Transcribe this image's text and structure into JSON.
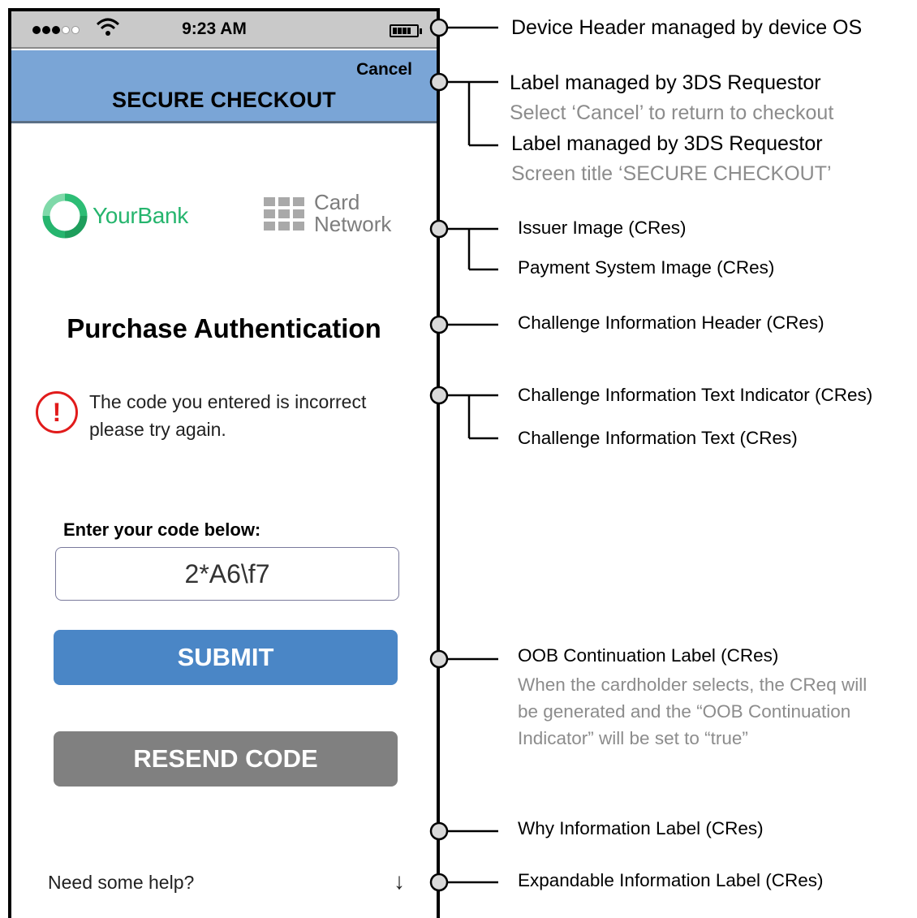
{
  "device": {
    "time": "9:23 AM",
    "signal_bars": 5,
    "signal_bars_filled": 3,
    "battery_level": 0.8,
    "icons": [
      "signal-dots-icon",
      "wifi-icon",
      "battery-icon"
    ]
  },
  "requestor": {
    "cancel_label": "Cancel",
    "screen_title": "SECURE CHECKOUT"
  },
  "issuer": {
    "logo_text": "YourBank",
    "logo_color": "#26b56e"
  },
  "payment_system": {
    "line1": "Card",
    "line2": "Network",
    "logo_color": "#a9a9a9"
  },
  "challenge": {
    "header": "Purchase Authentication",
    "indicator_icon": "error-exclamation-icon",
    "indicator_color": "#e11b1b",
    "text": "The code you entered is incorrect please try again.",
    "input_label": "Enter your code below:",
    "input_value": "2*A6\\f7"
  },
  "buttons": {
    "submit": {
      "label": "SUBMIT",
      "color": "#4a86c6"
    },
    "resend": {
      "label": "RESEND CODE",
      "color": "#808080"
    }
  },
  "help": {
    "label": "Need some help?",
    "icon": "down-arrow-icon"
  },
  "annotations": {
    "device_header": "Device Header managed by device OS",
    "cancel_label": "Label managed by 3DS Requestor",
    "cancel_note": "Select ‘Cancel’ to return to checkout",
    "title_label": "Label managed by 3DS Requestor",
    "title_note": "Screen title ‘SECURE CHECKOUT’",
    "issuer_image": "Issuer Image (CRes)",
    "payment_image": "Payment System Image (CRes)",
    "info_header": "Challenge Information Header (CRes)",
    "info_indicator": "Challenge Information Text Indicator (CRes)",
    "info_text": "Challenge Information Text (CRes)",
    "oob_label": "OOB Continuation Label (CRes)",
    "oob_note": "When the cardholder selects, the CReq will be generated and the “OOB Continuation Indicator” will be set to “true”",
    "why_info": "Why Information Label (CRes)",
    "expandable_info": "Expandable Information Label  (CRes)"
  }
}
